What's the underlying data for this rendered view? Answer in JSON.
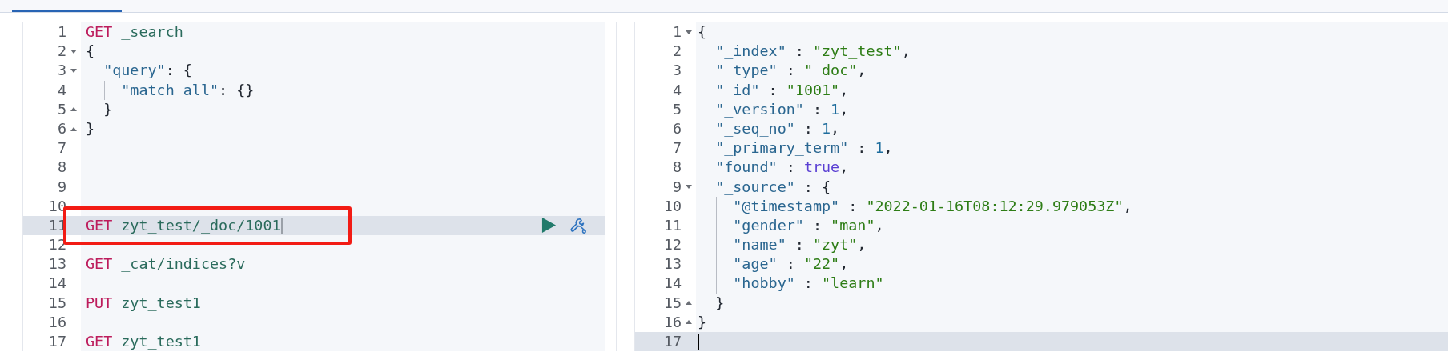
{
  "tab_bar": {
    "tabs": [
      {
        "selected": true
      }
    ]
  },
  "request_editor": {
    "focused": false,
    "lines": [
      {
        "number": "1",
        "tokens": [
          {
            "kind": "method",
            "text": "GET"
          },
          {
            "kind": "path",
            "text": " _search"
          }
        ]
      },
      {
        "number": "2",
        "foldable": true,
        "expanded": true,
        "tokens": [
          {
            "kind": "punct",
            "text": "{"
          }
        ]
      },
      {
        "number": "3",
        "foldable": true,
        "expanded": true,
        "tokens": [
          {
            "kind": "key",
            "text": "  \"query\""
          },
          {
            "kind": "punct",
            "text": ": {"
          }
        ]
      },
      {
        "number": "4",
        "guide": true,
        "tokens": [
          {
            "kind": "key",
            "text": "    \"match_all\""
          },
          {
            "kind": "punct",
            "text": ": {}"
          }
        ]
      },
      {
        "number": "5",
        "foldable": true,
        "expanded": false,
        "tokens": [
          {
            "kind": "punct",
            "text": "  }"
          }
        ]
      },
      {
        "number": "6",
        "foldable": true,
        "expanded": false,
        "tokens": [
          {
            "kind": "punct",
            "text": "}"
          }
        ]
      },
      {
        "number": "7"
      },
      {
        "number": "8"
      },
      {
        "number": "9"
      },
      {
        "number": "10"
      },
      {
        "number": "11",
        "active": true,
        "cursor": true,
        "actions": true,
        "annotated": true,
        "tokens": [
          {
            "kind": "method",
            "text": "GET"
          },
          {
            "kind": "path",
            "text": " zyt_test/_doc/1001"
          }
        ]
      },
      {
        "number": "12"
      },
      {
        "number": "13",
        "tokens": [
          {
            "kind": "method",
            "text": "GET"
          },
          {
            "kind": "path",
            "text": " _cat/indices?v"
          }
        ]
      },
      {
        "number": "14"
      },
      {
        "number": "15",
        "tokens": [
          {
            "kind": "method",
            "text": "PUT"
          },
          {
            "kind": "path",
            "text": " zyt_test1"
          }
        ]
      },
      {
        "number": "16"
      },
      {
        "number": "17",
        "tokens": [
          {
            "kind": "method",
            "text": "GET"
          },
          {
            "kind": "path",
            "text": " zyt_test1"
          }
        ]
      }
    ]
  },
  "response_editor": {
    "focused": true,
    "lines": [
      {
        "number": "1",
        "foldable": true,
        "expanded": true,
        "tokens": [
          {
            "kind": "punct",
            "text": "{"
          }
        ]
      },
      {
        "number": "2",
        "tokens": [
          {
            "kind": "key",
            "text": "  \"_index\""
          },
          {
            "kind": "punct",
            "text": " : "
          },
          {
            "kind": "string",
            "text": "\"zyt_test\""
          },
          {
            "kind": "punct",
            "text": ","
          }
        ]
      },
      {
        "number": "3",
        "tokens": [
          {
            "kind": "key",
            "text": "  \"_type\""
          },
          {
            "kind": "punct",
            "text": " : "
          },
          {
            "kind": "string",
            "text": "\"_doc\""
          },
          {
            "kind": "punct",
            "text": ","
          }
        ]
      },
      {
        "number": "4",
        "tokens": [
          {
            "kind": "key",
            "text": "  \"_id\""
          },
          {
            "kind": "punct",
            "text": " : "
          },
          {
            "kind": "string",
            "text": "\"1001\""
          },
          {
            "kind": "punct",
            "text": ","
          }
        ]
      },
      {
        "number": "5",
        "tokens": [
          {
            "kind": "key",
            "text": "  \"_version\""
          },
          {
            "kind": "punct",
            "text": " : "
          },
          {
            "kind": "number",
            "text": "1"
          },
          {
            "kind": "punct",
            "text": ","
          }
        ]
      },
      {
        "number": "6",
        "tokens": [
          {
            "kind": "key",
            "text": "  \"_seq_no\""
          },
          {
            "kind": "punct",
            "text": " : "
          },
          {
            "kind": "number",
            "text": "1"
          },
          {
            "kind": "punct",
            "text": ","
          }
        ]
      },
      {
        "number": "7",
        "tokens": [
          {
            "kind": "key",
            "text": "  \"_primary_term\""
          },
          {
            "kind": "punct",
            "text": " : "
          },
          {
            "kind": "number",
            "text": "1"
          },
          {
            "kind": "punct",
            "text": ","
          }
        ]
      },
      {
        "number": "8",
        "tokens": [
          {
            "kind": "key",
            "text": "  \"found\""
          },
          {
            "kind": "punct",
            "text": " : "
          },
          {
            "kind": "boolean",
            "text": "true"
          },
          {
            "kind": "punct",
            "text": ","
          }
        ]
      },
      {
        "number": "9",
        "foldable": true,
        "expanded": true,
        "tokens": [
          {
            "kind": "key",
            "text": "  \"_source\""
          },
          {
            "kind": "punct",
            "text": " : {"
          }
        ]
      },
      {
        "number": "10",
        "guide": true,
        "tokens": [
          {
            "kind": "key",
            "text": "    \"@timestamp\""
          },
          {
            "kind": "punct",
            "text": " : "
          },
          {
            "kind": "string",
            "text": "\"2022-01-16T08:12:29.979053Z\""
          },
          {
            "kind": "punct",
            "text": ","
          }
        ]
      },
      {
        "number": "11",
        "guide": true,
        "tokens": [
          {
            "kind": "key",
            "text": "    \"gender\""
          },
          {
            "kind": "punct",
            "text": " : "
          },
          {
            "kind": "string",
            "text": "\"man\""
          },
          {
            "kind": "punct",
            "text": ","
          }
        ]
      },
      {
        "number": "12",
        "guide": true,
        "tokens": [
          {
            "kind": "key",
            "text": "    \"name\""
          },
          {
            "kind": "punct",
            "text": " : "
          },
          {
            "kind": "string",
            "text": "\"zyt\""
          },
          {
            "kind": "punct",
            "text": ","
          }
        ]
      },
      {
        "number": "13",
        "guide": true,
        "tokens": [
          {
            "kind": "key",
            "text": "    \"age\""
          },
          {
            "kind": "punct",
            "text": " : "
          },
          {
            "kind": "string",
            "text": "\"22\""
          },
          {
            "kind": "punct",
            "text": ","
          }
        ]
      },
      {
        "number": "14",
        "guide": true,
        "tokens": [
          {
            "kind": "key",
            "text": "    \"hobby\""
          },
          {
            "kind": "punct",
            "text": " : "
          },
          {
            "kind": "string",
            "text": "\"learn\""
          }
        ]
      },
      {
        "number": "15",
        "foldable": true,
        "expanded": false,
        "tokens": [
          {
            "kind": "punct",
            "text": "  }"
          }
        ]
      },
      {
        "number": "16",
        "foldable": true,
        "expanded": false,
        "tokens": [
          {
            "kind": "punct",
            "text": "}"
          }
        ]
      },
      {
        "number": "17",
        "active": true,
        "cursor": true
      }
    ]
  }
}
